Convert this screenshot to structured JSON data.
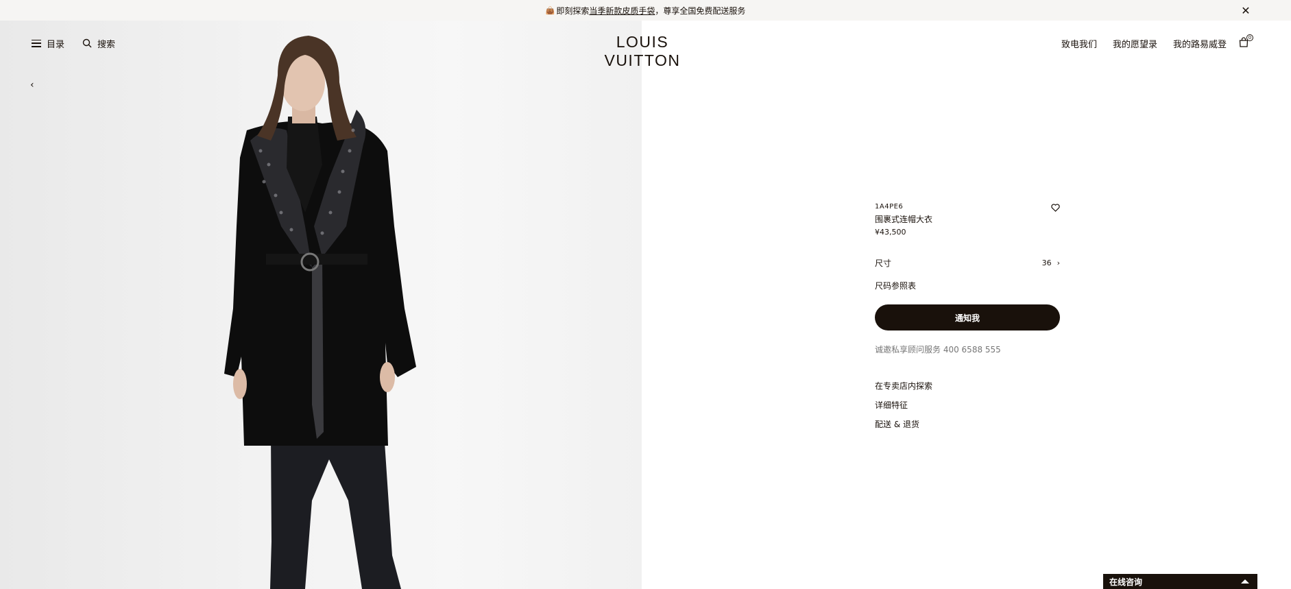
{
  "announcement": {
    "icon": "handbag-emoji-icon",
    "text_prefix": "即刻探索",
    "link_text": "当季新款皮质手袋",
    "text_suffix": "，尊享全国免费配送服务",
    "close_icon": "close-icon"
  },
  "header": {
    "menu_label": "目录",
    "search_label": "搜索",
    "logo": "LOUIS VUITTON",
    "nav": [
      "致电我们",
      "我的愿望录",
      "我的路易威登"
    ],
    "cart_count": "0"
  },
  "product": {
    "sku": "1A4PE6",
    "name": "围裹式连帽大衣",
    "price": "¥43,500",
    "size_label": "尺寸",
    "size_value": "36",
    "size_guide": "尺码参照表",
    "notify_button": "通知我",
    "advisor_text": "诚邀私享顾问服务 ",
    "advisor_phone": "400 6588 555",
    "links": [
      "在专卖店内探索",
      "详细特征",
      "配送 & 退货"
    ]
  },
  "chat": {
    "label": "在线咨询"
  },
  "colors": {
    "brand_dark": "#19110b",
    "announce_bg": "#f6f5f3",
    "muted_text": "#767676"
  }
}
